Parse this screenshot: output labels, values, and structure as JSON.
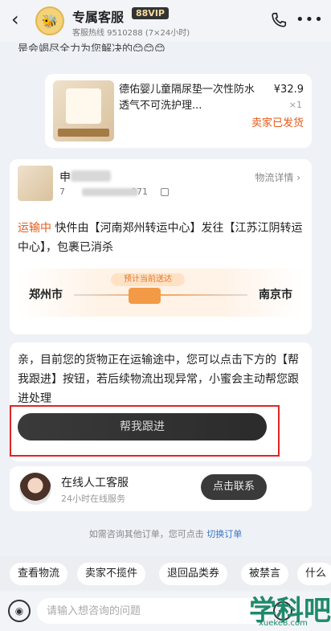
{
  "header": {
    "title": "专属客服",
    "badge": "88VIP",
    "subtitle": "客服热线 9510288 (7×24小时)"
  },
  "chat": {
    "cut_text": "是会竭尽全力为您解决的😊😊😊",
    "product": {
      "name": "德佑婴儿童隔尿垫一次性防水透气不可洗护理...",
      "price": "¥32.9",
      "qty": "×1",
      "status": "卖家已发货"
    },
    "logistics": {
      "name": "申",
      "number_prefix": "7",
      "number_suffix": "071",
      "detail_link": "物流详情 ›",
      "status": "运输中",
      "message": "快件由【河南郑州转运中心】发往【江苏江阴转运中心】，包裹已消杀",
      "from": "郑州市",
      "to": "南京市",
      "route_badge": "预计当前送达"
    },
    "help": {
      "text": "亲，目前您的货物正在运输途中，您可以点击下方的【帮我跟进】按钮，若后续物流出现异常，小蜜会主动帮您跟进处理",
      "button": "帮我跟进"
    },
    "agent": {
      "name": "在线人工客服",
      "sub": "24小时在线服务",
      "button": "点击联系"
    },
    "tip": {
      "text": "如需咨询其他订单，您可点击",
      "link": "切换订单"
    }
  },
  "quick_chips": [
    "查看物流",
    "卖家不揽件",
    "退回品类券",
    "被禁言",
    "什么"
  ],
  "input": {
    "placeholder": "请输入想咨询的问题"
  },
  "watermark": {
    "main": "学科吧",
    "sub": "xueke8.com"
  },
  "colors": {
    "accent_orange": "#e55b1c",
    "highlight_red": "#e02424",
    "link_blue": "#3a78c8"
  }
}
